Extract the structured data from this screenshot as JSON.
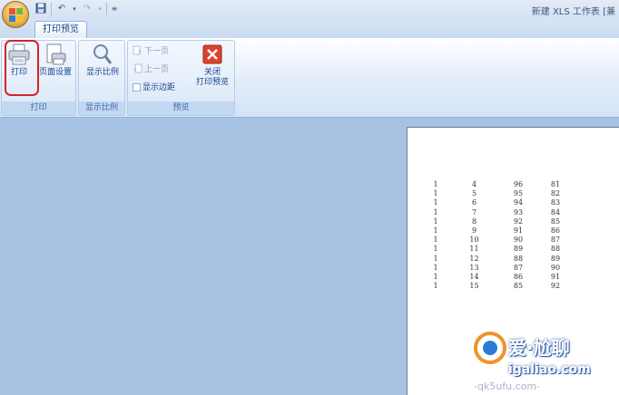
{
  "window": {
    "title": "新建 XLS 工作表 [兼"
  },
  "tabs": [
    {
      "label": "打印预览"
    }
  ],
  "ribbon": {
    "groups": [
      {
        "label": "打印",
        "buttons": [
          {
            "label": "打印",
            "icon": "printer-icon"
          },
          {
            "label": "页面设置",
            "icon": "page-setup-icon"
          }
        ]
      },
      {
        "label": "显示比例",
        "buttons": [
          {
            "label": "显示比例",
            "icon": "zoom-icon"
          }
        ]
      },
      {
        "label": "预览",
        "small_buttons": [
          {
            "label": "下一页",
            "enabled": false
          },
          {
            "label": "上一页",
            "enabled": false
          },
          {
            "label": "显示边距",
            "checked": false
          }
        ],
        "buttons": [
          {
            "label": "关闭\n打印预览",
            "label_line1": "关闭",
            "label_line2": "打印预览",
            "icon": "close-preview-icon"
          }
        ]
      }
    ]
  },
  "preview_table": {
    "rows": [
      [
        "1",
        "4",
        "96",
        "81"
      ],
      [
        "1",
        "5",
        "95",
        "82"
      ],
      [
        "1",
        "6",
        "94",
        "83"
      ],
      [
        "1",
        "7",
        "93",
        "84"
      ],
      [
        "1",
        "8",
        "92",
        "85"
      ],
      [
        "1",
        "9",
        "91",
        "86"
      ],
      [
        "1",
        "10",
        "90",
        "87"
      ],
      [
        "1",
        "11",
        "89",
        "88"
      ],
      [
        "1",
        "12",
        "88",
        "89"
      ],
      [
        "1",
        "13",
        "87",
        "90"
      ],
      [
        "1",
        "14",
        "86",
        "91"
      ],
      [
        "1",
        "15",
        "85",
        "92"
      ]
    ]
  },
  "watermark": {
    "text_main": "爱·尬聊",
    "text_url": "igaliao.com",
    "text_bottom": "-qk5ufu.com-"
  },
  "colors": {
    "accent": "#d0262a",
    "workspace": "#a8c2e4",
    "ribbon_text": "#15428b"
  }
}
